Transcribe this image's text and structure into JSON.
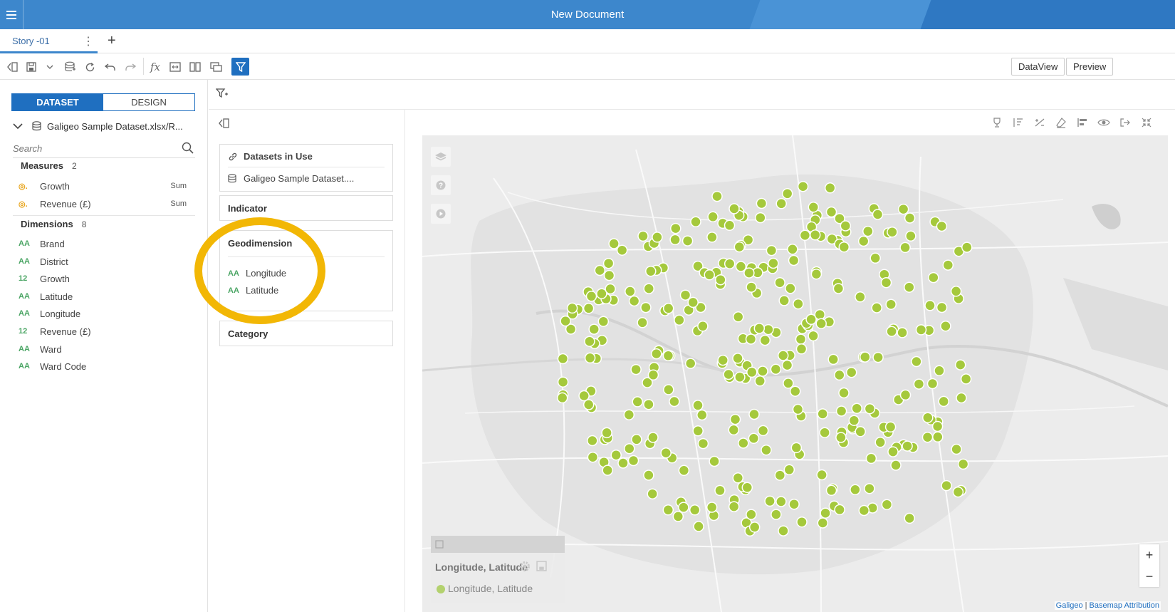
{
  "app": {
    "title": "New Document"
  },
  "tabs": {
    "story_label": "Story -01",
    "more_glyph": "⋮",
    "add_glyph": "+"
  },
  "toolbar": {
    "dataview_label": "DataView",
    "preview_label": "Preview",
    "fx_label": "fx"
  },
  "left_panel": {
    "dataset_tab": "DATASET",
    "design_tab": "DESIGN",
    "dataset_name": "Galigeo Sample Dataset.xlsx/R...",
    "search_placeholder": "Search",
    "measures": {
      "label": "Measures",
      "count": "2",
      "items": [
        {
          "label": "Growth",
          "agg": "Sum"
        },
        {
          "label": "Revenue (£)",
          "agg": "Sum"
        }
      ]
    },
    "dimensions": {
      "label": "Dimensions",
      "count": "8",
      "items": [
        {
          "label": "Brand",
          "type": "AA"
        },
        {
          "label": "District",
          "type": "AA"
        },
        {
          "label": "Growth",
          "type": "12"
        },
        {
          "label": "Latitude",
          "type": "AA"
        },
        {
          "label": "Longitude",
          "type": "AA"
        },
        {
          "label": "Revenue (£)",
          "type": "12"
        },
        {
          "label": "Ward",
          "type": "AA"
        },
        {
          "label": "Ward Code",
          "type": "AA"
        }
      ]
    }
  },
  "mid_panel": {
    "datasets_in_use_label": "Datasets in Use",
    "dataset_item": "Galigeo Sample Dataset....",
    "indicator_label": "Indicator",
    "geodimension_label": "Geodimension",
    "geodimension_items": [
      {
        "label": "Longitude",
        "type": "AA"
      },
      {
        "label": "Latitude",
        "type": "AA"
      }
    ],
    "category_label": "Category"
  },
  "map": {
    "legend_title": "Longitude, Latitude",
    "legend_item": "Longitude, Latitude",
    "zoom_in": "+",
    "zoom_out": "−",
    "attribution_galigeo": "Galigeo",
    "attribution_sep": " | ",
    "attribution_basemap": "Basemap Attribution",
    "point_color": "#a5c93c"
  },
  "colors": {
    "accent": "#1f6fc0",
    "header": "#3d87cc",
    "highlight": "#f2b705"
  }
}
